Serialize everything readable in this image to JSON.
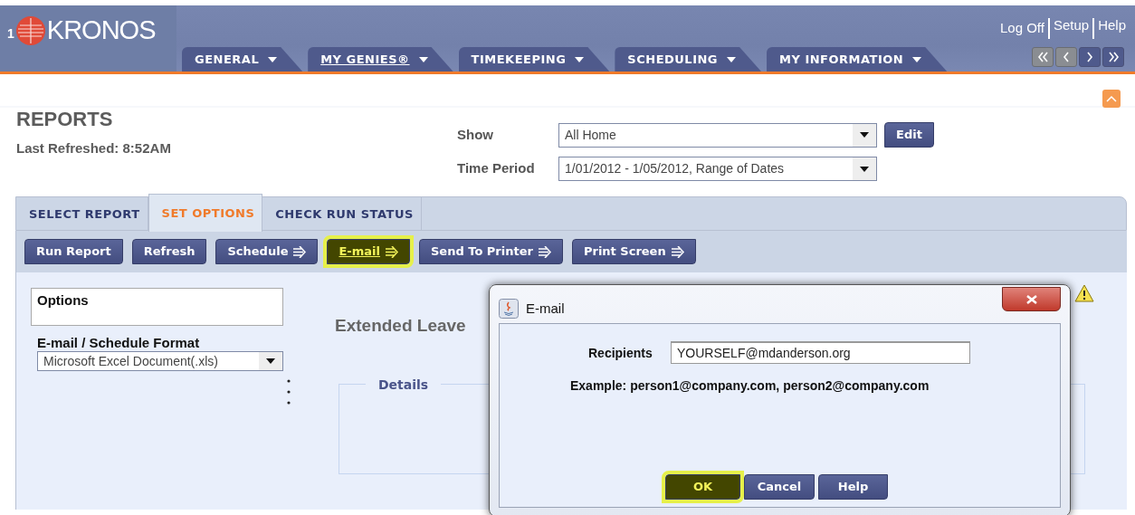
{
  "header": {
    "logo_prefix": "1",
    "logo": "KRONOS",
    "links": [
      "Log Off",
      "Setup",
      "Help"
    ],
    "tabs": [
      {
        "label": "GENERAL",
        "selected": false
      },
      {
        "label": "MY GENIES®",
        "selected": true
      },
      {
        "label": "TIMEKEEPING",
        "selected": false
      },
      {
        "label": "SCHEDULING",
        "selected": false
      },
      {
        "label": "MY INFORMATION",
        "selected": false
      }
    ],
    "pager": [
      {
        "kind": "first",
        "disabled": true
      },
      {
        "kind": "prev",
        "disabled": true
      },
      {
        "kind": "next",
        "disabled": false
      },
      {
        "kind": "last",
        "disabled": false
      }
    ]
  },
  "page": {
    "title": "REPORTS",
    "refreshed": "Last Refreshed: 8:52AM",
    "filters": [
      {
        "label": "Show",
        "value": "All Home"
      },
      {
        "label": "Time Period",
        "value": "1/01/2012 - 1/05/2012, Range of Dates"
      }
    ],
    "edit_button": "Edit"
  },
  "report_tabs": [
    {
      "label": "SELECT REPORT",
      "selected": false
    },
    {
      "label": "SET OPTIONS",
      "selected": true
    },
    {
      "label": "CHECK RUN STATUS",
      "selected": false
    }
  ],
  "toolbar": [
    {
      "label": "Run Report",
      "arrow": false,
      "highlighted": false
    },
    {
      "label": "Refresh",
      "arrow": false,
      "highlighted": false
    },
    {
      "label": "Schedule",
      "arrow": true,
      "highlighted": false
    },
    {
      "label": "E-mail",
      "arrow": true,
      "highlighted": true
    },
    {
      "label": "Send To Printer",
      "arrow": true,
      "highlighted": false
    },
    {
      "label": "Print Screen",
      "arrow": true,
      "highlighted": false
    }
  ],
  "options": {
    "title": "Options",
    "format_label": "E-mail / Schedule Format",
    "format_value": "Microsoft Excel Document(.xls)"
  },
  "report_title": "Extended Leave",
  "details_legend": "Details",
  "dialog": {
    "title": "E-mail",
    "recipients_label": "Recipients",
    "recipients_value": "YOURSELF@mdanderson.org",
    "example": "Example: person1@company.com, person2@company.com",
    "buttons": [
      {
        "label": "OK",
        "highlighted": true
      },
      {
        "label": "Cancel",
        "highlighted": false
      },
      {
        "label": "Help",
        "highlighted": false
      }
    ]
  }
}
